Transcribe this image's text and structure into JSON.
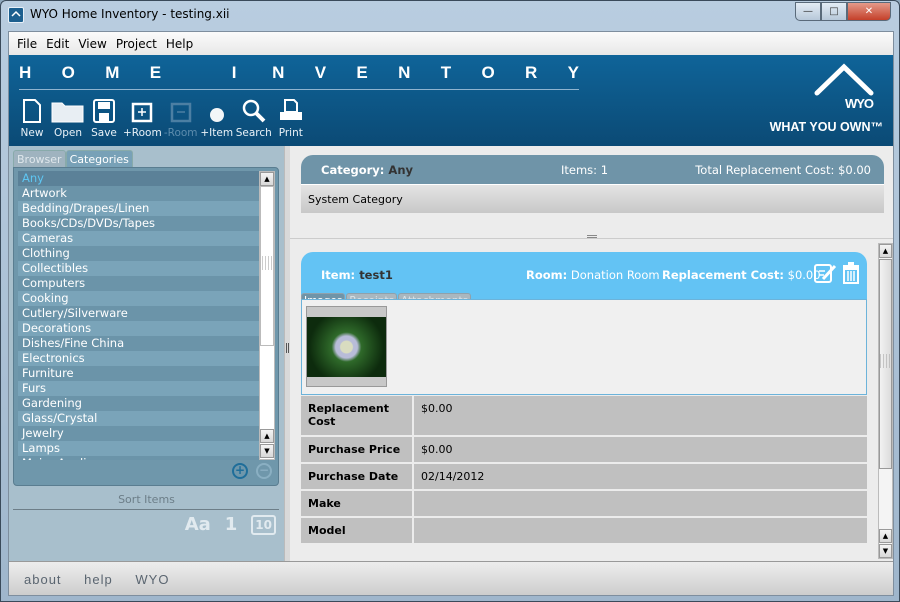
{
  "window": {
    "title": "WYO Home Inventory - testing.xii",
    "controls": {
      "minimize": "—",
      "maximize": "□",
      "close": "✕"
    }
  },
  "menu": [
    "File",
    "Edit",
    "View",
    "Project",
    "Help"
  ],
  "banner": {
    "brand_letters": [
      "H",
      "O",
      "M",
      "E",
      "",
      "I",
      "N",
      "V",
      "E",
      "N",
      "T",
      "O",
      "R",
      "Y"
    ],
    "logo_mark": "WYO",
    "logo_tagline": "WHAT YOU OWN™"
  },
  "toolbar": [
    {
      "id": "new",
      "label": "New",
      "icon": "new-document-icon",
      "enabled": true
    },
    {
      "id": "open",
      "label": "Open",
      "icon": "folder-icon",
      "enabled": true
    },
    {
      "id": "save",
      "label": "Save",
      "icon": "save-icon",
      "enabled": true
    },
    {
      "id": "add-room",
      "label": "+Room",
      "icon": "add-room-icon",
      "enabled": true
    },
    {
      "id": "remove-room",
      "label": "-Room",
      "icon": "remove-room-icon",
      "enabled": false
    },
    {
      "id": "add-item",
      "label": "+Item",
      "icon": "add-item-icon",
      "enabled": true
    },
    {
      "id": "search",
      "label": "Search",
      "icon": "search-icon",
      "enabled": true
    },
    {
      "id": "print",
      "label": "Print",
      "icon": "print-icon",
      "enabled": true
    }
  ],
  "sidebar": {
    "tabs": [
      {
        "label": "Browser",
        "active": false
      },
      {
        "label": "Categories",
        "active": true
      }
    ],
    "categories": [
      "Any",
      "Artwork",
      "Bedding/Drapes/Linen",
      "Books/CDs/DVDs/Tapes",
      "Cameras",
      "Clothing",
      "Collectibles",
      "Computers",
      "Cooking",
      "Cutlery/Silverware",
      "Decorations",
      "Dishes/Fine China",
      "Electronics",
      "Furniture",
      "Furs",
      "Gardening",
      "Glass/Crystal",
      "Jewelry",
      "Lamps",
      "Major Appliances"
    ],
    "selected": "Any",
    "add_icon": "+",
    "remove_icon": "−",
    "sort_label": "Sort Items",
    "sort_icons": [
      {
        "glyph": "Aa",
        "name": "sort-alpha-icon"
      },
      {
        "glyph": "1",
        "name": "sort-number-icon"
      },
      {
        "glyph": "10",
        "name": "sort-date-icon"
      }
    ]
  },
  "category_panel": {
    "label": "Category:",
    "value": "Any",
    "items": "Items: 1",
    "total": "Total Replacement Cost: $0.00",
    "description": "System Category"
  },
  "item": {
    "name_label": "Item:",
    "name": "test1",
    "room_label": "Room:",
    "room": "Donation Room",
    "cost_label": "Replacement Cost:",
    "cost": "$0.00",
    "tabs": [
      {
        "label": "Images",
        "active": true
      },
      {
        "label": "Receipts",
        "active": false
      },
      {
        "label": "Attachments",
        "active": false
      }
    ],
    "properties": [
      {
        "key": "Replacement Cost",
        "value": "$0.00"
      },
      {
        "key": "Purchase Price",
        "value": "$0.00"
      },
      {
        "key": "Purchase Date",
        "value": "02/14/2012"
      },
      {
        "key": "Make",
        "value": ""
      },
      {
        "key": "Model",
        "value": ""
      }
    ]
  },
  "footer": [
    "about",
    "help",
    "WYO"
  ]
}
